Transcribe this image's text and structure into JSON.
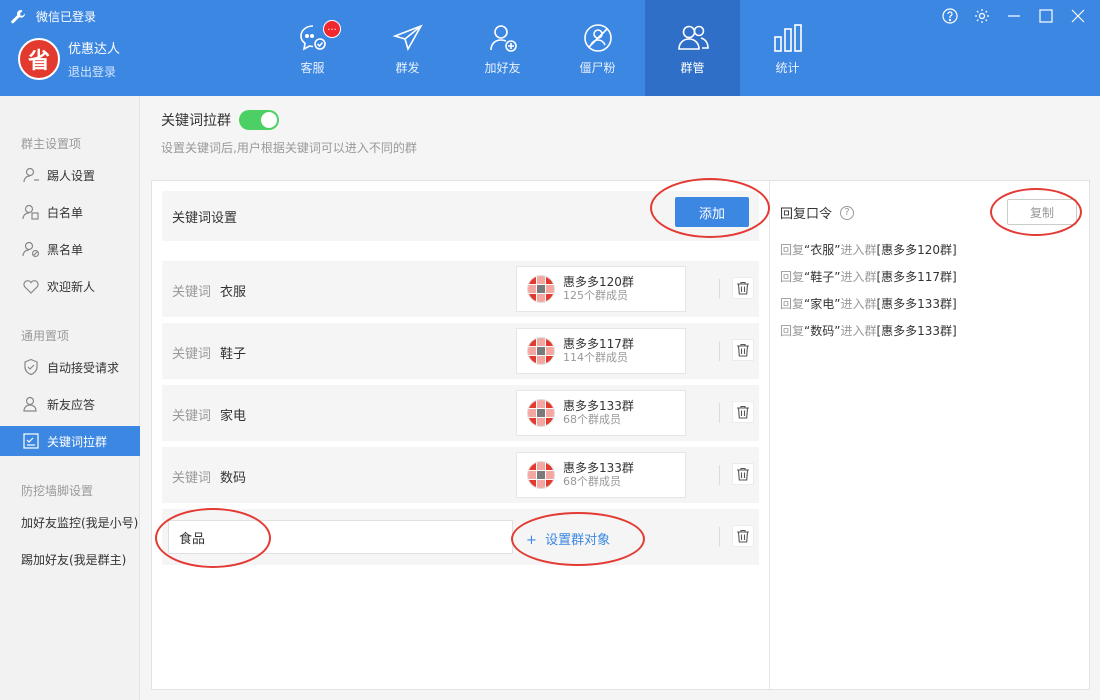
{
  "app": {
    "status_title": "微信已登录",
    "user_name": "优惠达人",
    "logout": "退出登录",
    "avatar_char": "省"
  },
  "nav": {
    "items": [
      {
        "label": "客服",
        "icon": "chat-icon",
        "badge": "..."
      },
      {
        "label": "群发",
        "icon": "send-icon"
      },
      {
        "label": "加好友",
        "icon": "add-friend-icon"
      },
      {
        "label": "僵尸粉",
        "icon": "zombie-icon"
      },
      {
        "label": "群管",
        "icon": "group-icon",
        "active": true
      },
      {
        "label": "统计",
        "icon": "stats-icon"
      }
    ]
  },
  "window_controls": [
    "help-icon",
    "settings-icon",
    "minimize-icon",
    "maximize-icon",
    "close-icon"
  ],
  "sidebar": {
    "section1": "群主设置项",
    "items1": [
      "踢人设置",
      "白名单",
      "黑名单",
      "欢迎新人"
    ],
    "section2": "通用置项",
    "items2": [
      "自动接受请求",
      "新友应答",
      "关键词拉群"
    ],
    "section3": "防挖墙脚设置",
    "items3": [
      "加好友监控(我是小号)",
      "踢加好友(我是群主)"
    ]
  },
  "main": {
    "title": "关键词拉群",
    "toggle_on": true,
    "description": "设置关键词后,用户根据关键词可以进入不同的群",
    "keyword_settings_label": "关键词设置",
    "add_button": "添加",
    "keyword_label": "关键词",
    "rows": [
      {
        "keyword": "衣服",
        "group_name": "惠多多120群",
        "group_count": "125个群成员"
      },
      {
        "keyword": "鞋子",
        "group_name": "惠多多117群",
        "group_count": "114个群成员"
      },
      {
        "keyword": "家电",
        "group_name": "惠多多133群",
        "group_count": "68个群成员"
      },
      {
        "keyword": "数码",
        "group_name": "惠多多133群",
        "group_count": "68个群成员"
      }
    ],
    "new_row": {
      "input_value": "食品",
      "set_target": "设置群对象",
      "plus": "+"
    }
  },
  "reply": {
    "title": "回复口令",
    "help": "?",
    "copy_button": "复制",
    "lines": [
      {
        "pre": "回复",
        "q": "“衣服”",
        "mid": "进入群",
        "grp": "[惠多多120群]"
      },
      {
        "pre": "回复",
        "q": "“鞋子”",
        "mid": "进入群",
        "grp": "[惠多多117群]"
      },
      {
        "pre": "回复",
        "q": "“家电”",
        "mid": "进入群",
        "grp": "[惠多多133群]"
      },
      {
        "pre": "回复",
        "q": "“数码”",
        "mid": "进入群",
        "grp": "[惠多多133群]"
      }
    ]
  },
  "colors": {
    "accent": "#3c87e2",
    "nav_active": "#2f6fc7",
    "toggle": "#4cd064",
    "annotation": "#e33a33"
  }
}
